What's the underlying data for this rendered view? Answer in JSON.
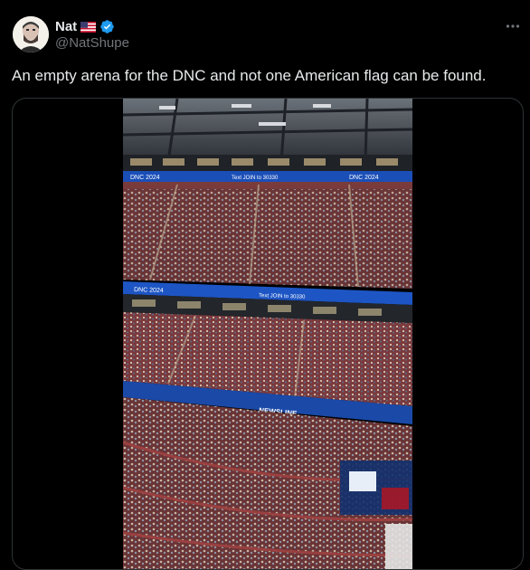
{
  "author": {
    "display_name": "Nat",
    "handle": "@NatShupe",
    "flag_icon": "us-flag-icon",
    "verified_icon": "verified-badge-icon"
  },
  "tweet": {
    "text": "An empty arena for the DNC and not one American flag can be found."
  },
  "media": {
    "type": "video",
    "ribbon_texts": [
      "DNC 2024",
      "Text JOIN to 30330",
      "Text JOIN to 30330",
      "DNC 2024"
    ],
    "screen_text": "NEWSLINE"
  },
  "colors": {
    "background": "#000000",
    "text_primary": "#e7e9ea",
    "text_secondary": "#71767b",
    "verified_blue": "#1d9bf0",
    "border": "#2f3336"
  }
}
